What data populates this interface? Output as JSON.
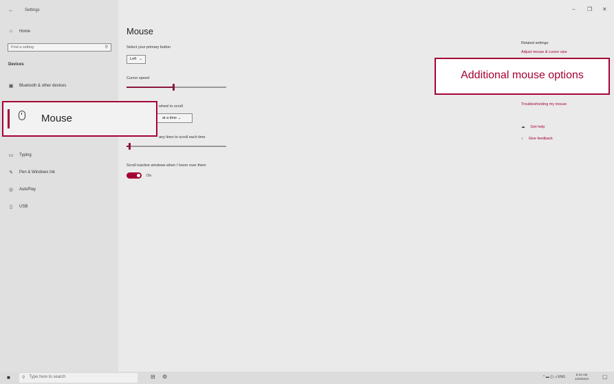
{
  "window": {
    "title": "Settings",
    "back_icon": "back-arrow-icon",
    "controls": {
      "minimize": "–",
      "restore": "❐",
      "close": "✕"
    }
  },
  "sidebar": {
    "home": {
      "label": "Home",
      "icon": "home-icon"
    },
    "search_placeholder": "Find a setting",
    "section_heading": "Devices",
    "items": [
      {
        "label": "Bluetooth & other devices",
        "icon": "bluetooth-devices-icon"
      },
      {
        "label": "Typing",
        "icon": "keyboard-icon"
      },
      {
        "label": "Pen & Windows Ink",
        "icon": "pen-icon"
      },
      {
        "label": "AutoPlay",
        "icon": "autoplay-icon"
      },
      {
        "label": "USB",
        "icon": "usb-icon"
      }
    ]
  },
  "main": {
    "title": "Mouse",
    "primary_button": {
      "label": "Select your primary button",
      "value": "Left"
    },
    "cursor_speed": {
      "label": "Cursor speed",
      "value_fraction": 0.47
    },
    "wheel_scroll": {
      "label": "wheel to scroll",
      "value": "at a time"
    },
    "lines_to_scroll": {
      "label": "any lines to scroll each time",
      "value_fraction": 0.03
    },
    "inactive_scroll": {
      "label": "Scroll inactive windows when I hover over them",
      "state": "On"
    }
  },
  "related": {
    "heading": "Related settings",
    "link_top": "Adjust mouse & cursor size",
    "link_troubleshoot": "Troubleshooting my mouse",
    "get_help": "Get help",
    "give_feedback": "Give feedback"
  },
  "callouts": {
    "mouse": "Mouse",
    "additional": "Additional mouse options"
  },
  "taskbar": {
    "search_placeholder": "Type here to search",
    "time": "8:15 AM",
    "date": "1/20/2023",
    "lang": "ENG"
  },
  "colors": {
    "accent": "#a50034"
  }
}
